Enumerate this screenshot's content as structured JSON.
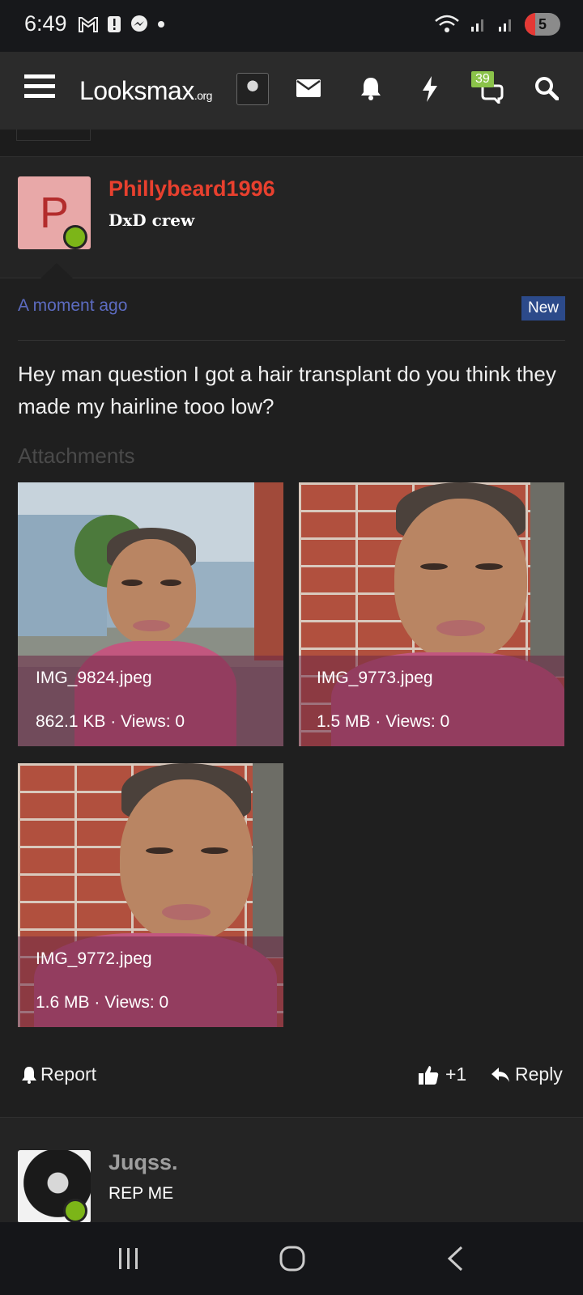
{
  "status_bar": {
    "time": "6:49",
    "battery_level": 5,
    "battery_fill_fraction": 0.3
  },
  "header": {
    "logo": "Looksmax",
    "logo_suffix": ".org",
    "conversations_badge": "39",
    "icons": [
      "menu-icon",
      "inbox-icon",
      "alerts-icon",
      "whats-new-icon",
      "conversations-icon",
      "search-icon"
    ]
  },
  "post": {
    "username": "Phillybeard1996",
    "user_title": "DxD crew",
    "avatar_letter": "P",
    "timestamp": "A moment ago",
    "new_label": "New",
    "message": "Hey man question I got a hair transplant do you think they made my hairline tooo low?",
    "attachments_title": "Attachments",
    "attachments": [
      {
        "filename": "IMG_9824.jpeg",
        "meta": "862.1 KB · Views: 0"
      },
      {
        "filename": "IMG_9773.jpeg",
        "meta": "1.5 MB · Views: 0"
      },
      {
        "filename": "IMG_9772.jpeg",
        "meta": "1.6 MB · Views: 0"
      }
    ],
    "actions": {
      "report": "Report",
      "like": "+1",
      "reply": "Reply"
    }
  },
  "next_post": {
    "username": "Juqss.",
    "user_title": "REP ME"
  },
  "colors": {
    "username_red": "#e8402e",
    "timestamp_blue": "#5c6bc0",
    "online_green": "#7cb518",
    "badge_green": "#8bc34a",
    "new_badge_blue": "#2c4a8a"
  }
}
